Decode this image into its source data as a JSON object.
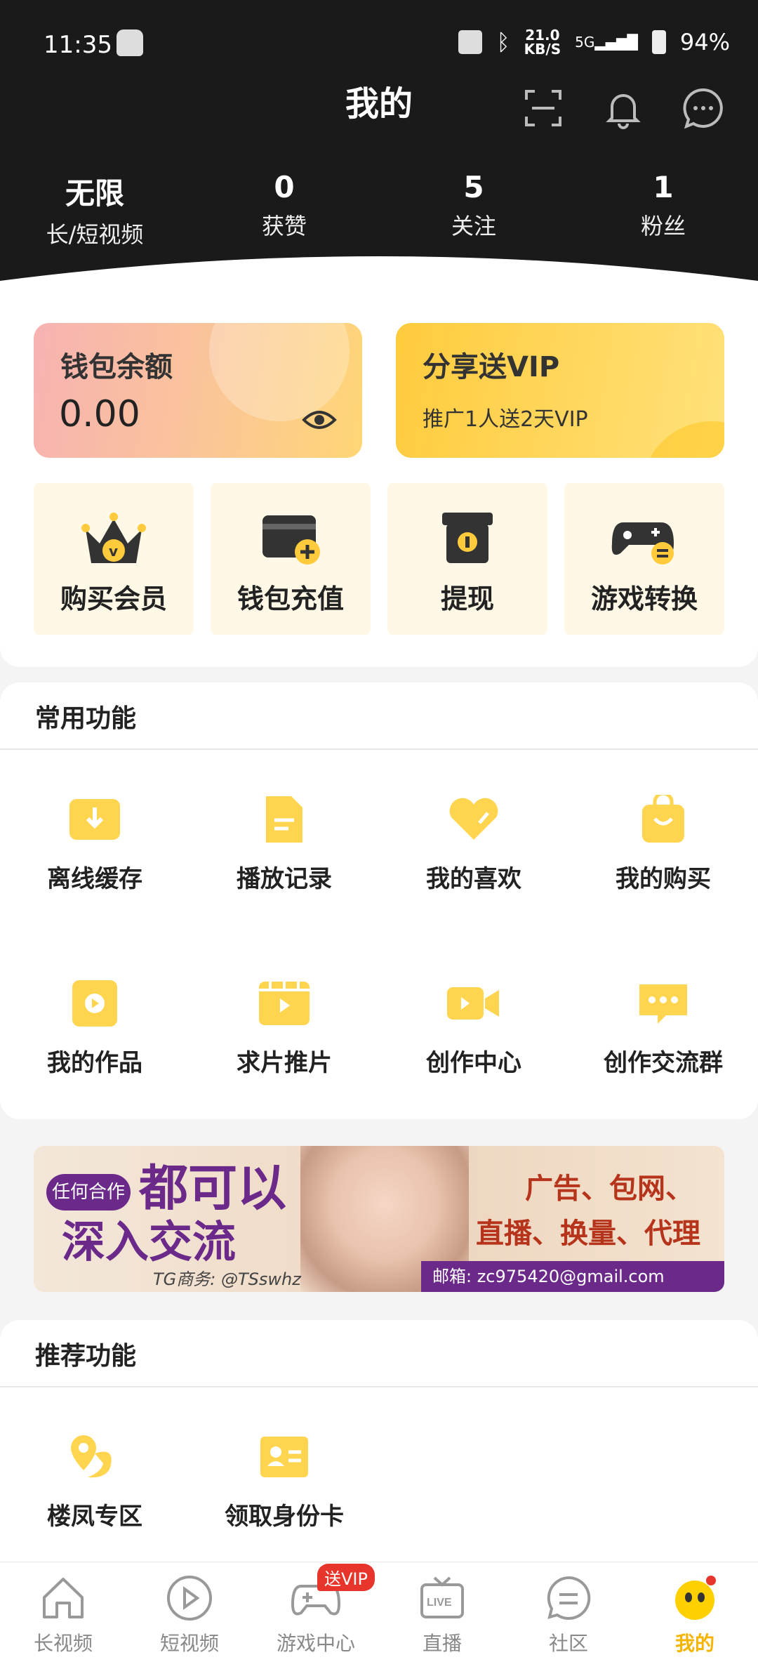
{
  "status": {
    "time": "11:35",
    "net_speed_value": "21.0",
    "net_speed_unit": "KB/S",
    "network": "5G",
    "battery": "94%"
  },
  "header": {
    "title": "我的"
  },
  "stats": [
    {
      "value": "无限",
      "label": "长/短视频"
    },
    {
      "value": "0",
      "label": "获赞"
    },
    {
      "value": "5",
      "label": "关注"
    },
    {
      "value": "1",
      "label": "粉丝"
    }
  ],
  "wallet": {
    "title": "钱包余额",
    "amount": "0.00"
  },
  "share": {
    "title": "分享送VIP",
    "subtitle": "推广1人送2天VIP"
  },
  "quick_actions": [
    {
      "label": "购买会员",
      "icon": "crown-icon"
    },
    {
      "label": "钱包充值",
      "icon": "wallet-add-icon"
    },
    {
      "label": "提现",
      "icon": "withdraw-box-icon"
    },
    {
      "label": "游戏转换",
      "icon": "game-exchange-icon"
    }
  ],
  "common": {
    "title": "常用功能",
    "items": [
      {
        "label": "离线缓存",
        "icon": "download-icon"
      },
      {
        "label": "播放记录",
        "icon": "document-icon"
      },
      {
        "label": "我的喜欢",
        "icon": "heart-icon"
      },
      {
        "label": "我的购买",
        "icon": "shopping-bag-icon"
      },
      {
        "label": "我的作品",
        "icon": "play-square-icon"
      },
      {
        "label": "求片推片",
        "icon": "film-icon"
      },
      {
        "label": "创作中心",
        "icon": "video-camera-icon"
      },
      {
        "label": "创作交流群",
        "icon": "chat-bubble-icon"
      }
    ]
  },
  "banner": {
    "left_small": "任何合作",
    "big_1": "都可以",
    "big_2": "深入交流",
    "tg": "TG商务: @TSswhz",
    "right_1": "广告、包网、",
    "right_2": "直播、换量、代理",
    "email": "邮箱: zc975420@gmail.com"
  },
  "recommended": {
    "title": "推荐功能",
    "items": [
      {
        "label": "楼凤专区",
        "icon": "location-pin-icon"
      },
      {
        "label": "领取身份卡",
        "icon": "id-card-icon"
      }
    ]
  },
  "nav": {
    "items": [
      {
        "label": "长视频",
        "icon": "home-icon"
      },
      {
        "label": "短视频",
        "icon": "play-circle-icon"
      },
      {
        "label": "游戏中心",
        "icon": "gamepad-icon",
        "badge": "送VIP"
      },
      {
        "label": "直播",
        "icon": "live-tv-icon"
      },
      {
        "label": "社区",
        "icon": "community-icon"
      },
      {
        "label": "我的",
        "icon": "mascot-icon"
      }
    ],
    "active": "我的"
  },
  "colors": {
    "accent": "#ffd54f",
    "active_nav": "#f4b400",
    "header_bg": "#1a1a1a"
  }
}
